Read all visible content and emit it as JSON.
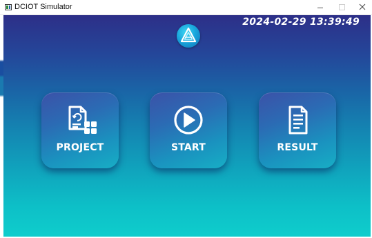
{
  "window": {
    "title": "DCIOT Simulator",
    "controls": {
      "minimize": "minimize",
      "maximize": "maximize",
      "close": "close"
    }
  },
  "header": {
    "datetime": "2024-02-29 13:39:49",
    "logo_icon": "triangle-logo-icon"
  },
  "tiles": [
    {
      "label": "PROJECT",
      "icon": "project-document-grid-icon"
    },
    {
      "label": "START",
      "icon": "play-icon"
    },
    {
      "label": "RESULT",
      "icon": "document-lines-icon"
    }
  ],
  "colors": {
    "gradient_top": "#2d2f88",
    "gradient_bottom": "#0fcdcc",
    "tile_top": "#3b52a8",
    "tile_bottom": "#17aec5",
    "logo": "#18a6dc",
    "text": "#ffffff"
  }
}
